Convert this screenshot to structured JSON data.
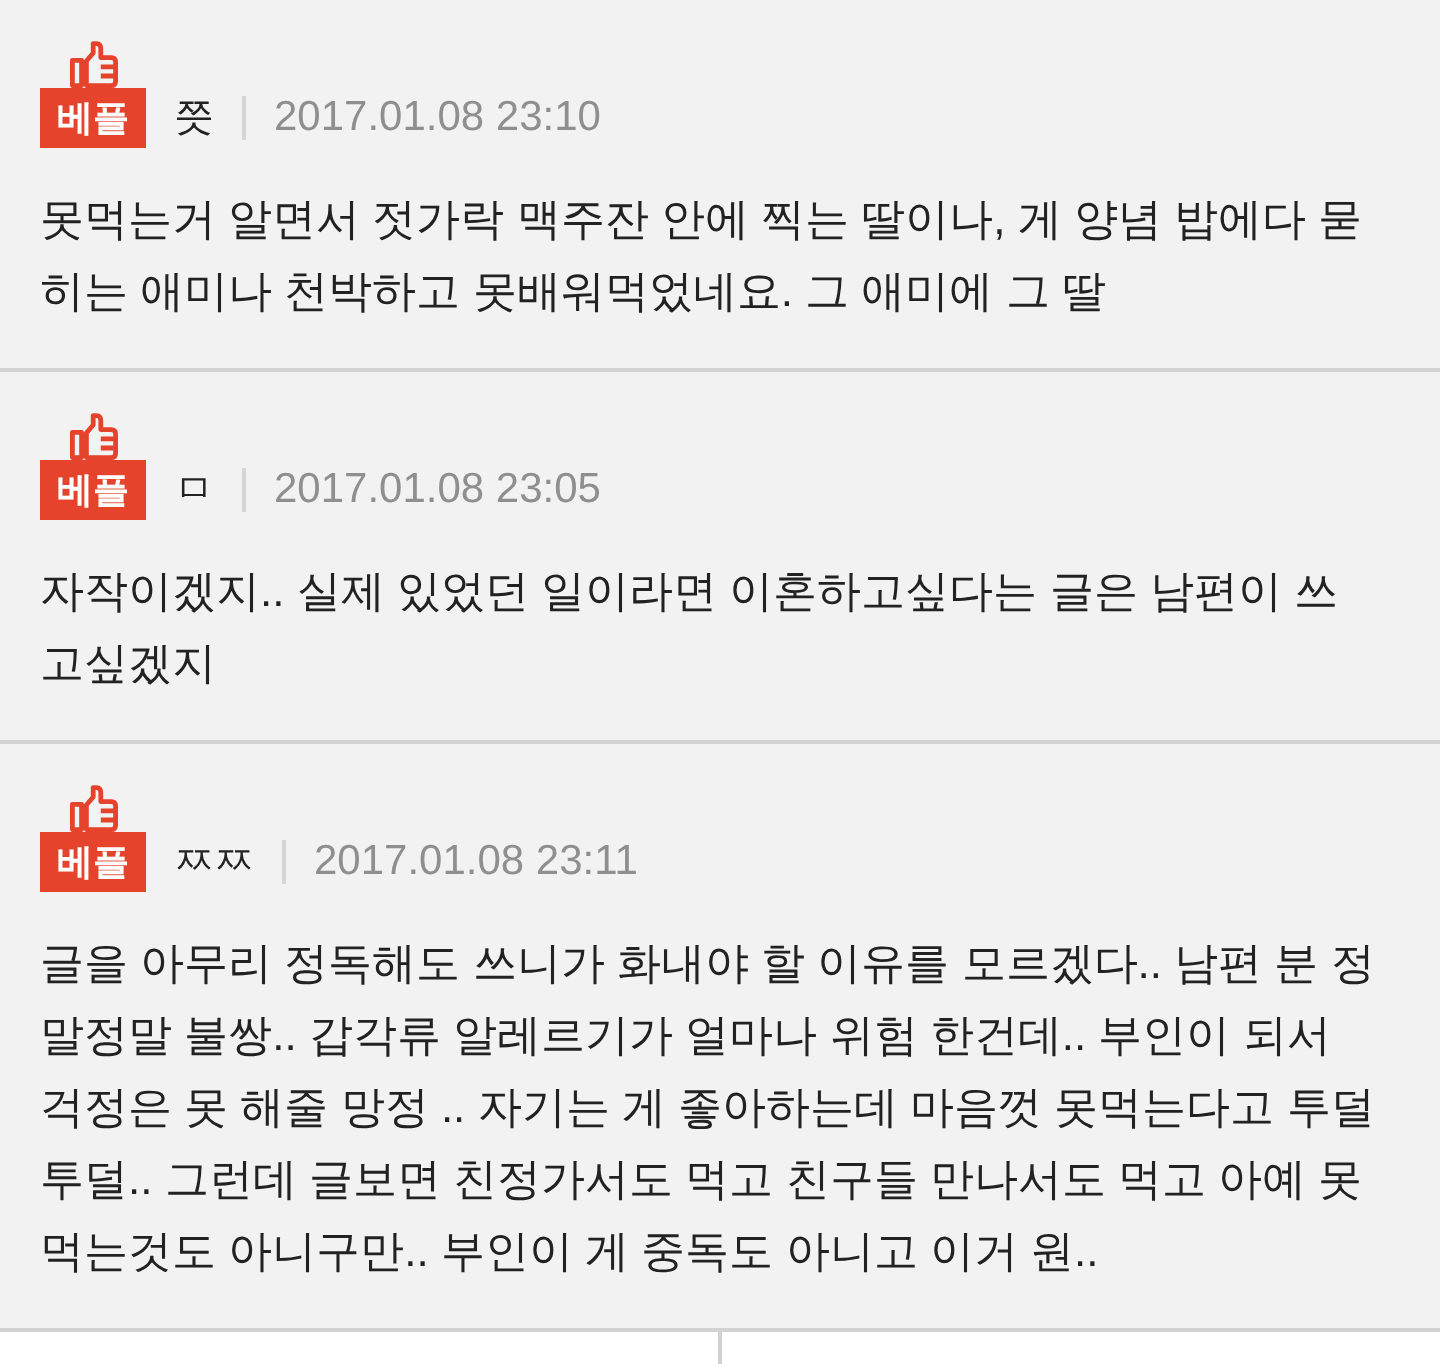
{
  "comments": [
    {
      "badge": "베플",
      "author": "쯧",
      "date": "2017.01.08 23:10",
      "text": "못먹는거 알면서 젓가락 맥주잔 안에 찍는 딸이나, 게 양념 밥에다 묻히는 애미나 천박하고 못배워먹었네요. 그 애미에 그 딸"
    },
    {
      "badge": "베플",
      "author": "ㅁ",
      "date": "2017.01.08 23:05",
      "text": "자작이겠지.. 실제 있었던 일이라면 이혼하고싶다는 글은 남편이 쓰고싶겠지"
    },
    {
      "badge": "베플",
      "author": "ㅉㅉ",
      "date": "2017.01.08 23:11",
      "text": "글을 아무리 정독해도 쓰니가 화내야 할 이유를 모르겠다.. 남편 분 정말정말 불쌍.. 갑각류 알레르기가 얼마나 위험 한건데.. 부인이 되서 걱정은 못 해줄 망정 .. 자기는 게 좋아하는데 마음껏 못먹는다고 투덜투덜.. 그런데 글보면 친정가서도 먹고 친구들 만나서도 먹고 아예 못먹는것도 아니구만.. 부인이 게 중독도 아니고 이거 원.."
    }
  ]
}
